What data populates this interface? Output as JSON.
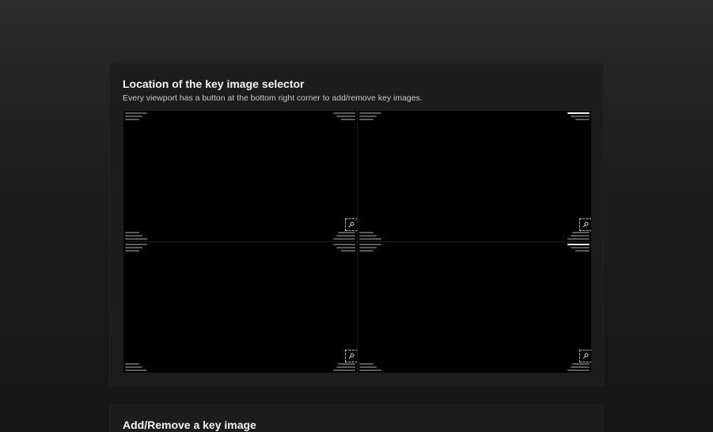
{
  "section_1": {
    "title": "Location of the key image selector",
    "description": "Every viewport has a button at the bottom right corner to add/remove key images."
  },
  "section_2": {
    "title": "Add/Remove a key image"
  },
  "viewports": [
    {
      "id": "viewport-1",
      "active": false,
      "key_image_button_icon": "key-icon"
    },
    {
      "id": "viewport-2",
      "active": true,
      "key_image_button_icon": "key-icon"
    },
    {
      "id": "viewport-3",
      "active": false,
      "key_image_button_icon": "key-icon"
    },
    {
      "id": "viewport-4",
      "active": true,
      "key_image_button_icon": "key-icon"
    }
  ],
  "colors": {
    "background": "#1a1a1a",
    "card": "#1c1c1c",
    "viewport": "#000000",
    "overlay_text_placeholder": "#5b5b5b",
    "highlight": "#f2f2f2"
  }
}
